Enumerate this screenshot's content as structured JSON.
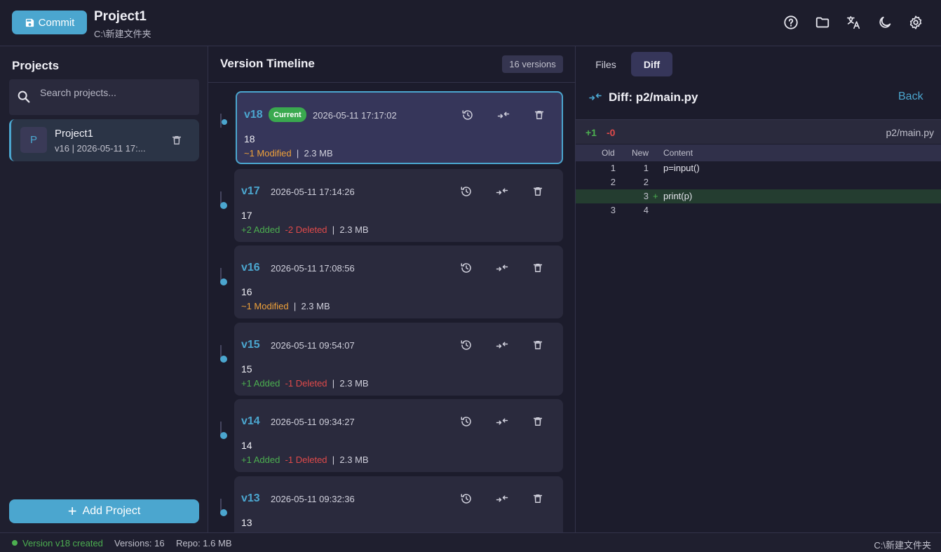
{
  "colors": {
    "accent": "#4ba6cf",
    "added": "#4caf50",
    "deleted": "#e04a4a",
    "modified": "#f0a23a",
    "current_badge": "#3aa94f"
  },
  "header": {
    "commit_label": "Commit",
    "project_title": "Project1",
    "project_path": "C:\\新建文件夹",
    "icons": [
      "help-icon",
      "folder-icon",
      "translate-icon",
      "dark-mode-icon",
      "settings-icon"
    ]
  },
  "sidebar": {
    "title": "Projects",
    "search_placeholder": "Search projects...",
    "projects": [
      {
        "avatar": "P",
        "name": "Project1",
        "meta": "v16  |  2026-05-11 17:..."
      }
    ],
    "add_label": "Add Project"
  },
  "timeline": {
    "title": "Version Timeline",
    "count": "16 versions",
    "versions": [
      {
        "label": "v18",
        "current": true,
        "badge": "Current",
        "date": "2026-05-11 17:17:02",
        "message": "18",
        "modified": "~1 Modified",
        "added": "",
        "deleted": "",
        "sep": "|",
        "size": "2.3 MB"
      },
      {
        "label": "v17",
        "current": false,
        "badge": "",
        "date": "2026-05-11 17:14:26",
        "message": "17",
        "modified": "",
        "added": "+2 Added",
        "deleted": "-2 Deleted",
        "sep": "|",
        "size": "2.3 MB"
      },
      {
        "label": "v16",
        "current": false,
        "badge": "",
        "date": "2026-05-11 17:08:56",
        "message": "16",
        "modified": "~1 Modified",
        "added": "",
        "deleted": "",
        "sep": "|",
        "size": "2.3 MB"
      },
      {
        "label": "v15",
        "current": false,
        "badge": "",
        "date": "2026-05-11 09:54:07",
        "message": "15",
        "modified": "",
        "added": "+1 Added",
        "deleted": "-1 Deleted",
        "sep": "|",
        "size": "2.3 MB"
      },
      {
        "label": "v14",
        "current": false,
        "badge": "",
        "date": "2026-05-11 09:34:27",
        "message": "14",
        "modified": "",
        "added": "+1 Added",
        "deleted": "-1 Deleted",
        "sep": "|",
        "size": "2.3 MB"
      },
      {
        "label": "v13",
        "current": false,
        "badge": "",
        "date": "2026-05-11 09:32:36",
        "message": "13",
        "modified": "",
        "added": "",
        "deleted": "",
        "sep": "",
        "size": ""
      }
    ]
  },
  "diff": {
    "tabs": [
      "Files",
      "Diff"
    ],
    "active_tab": "Diff",
    "title": "Diff: p2/main.py",
    "back_label": "Back",
    "summary_added": "+1",
    "summary_deleted": "-0",
    "file": "p2/main.py",
    "columns": [
      "Old",
      "New",
      "Content"
    ],
    "rows": [
      {
        "old": "1",
        "new": "1",
        "mark": "",
        "content": "p=input()",
        "type": "context"
      },
      {
        "old": "2",
        "new": "2",
        "mark": "",
        "content": "",
        "type": "context"
      },
      {
        "old": "",
        "new": "3",
        "mark": "+",
        "content": "print(p)",
        "type": "added"
      },
      {
        "old": "3",
        "new": "4",
        "mark": "",
        "content": "",
        "type": "context"
      }
    ]
  },
  "statusbar": {
    "message": "Version v18 created",
    "versions": "Versions: 16",
    "repo": "Repo: 1.6 MB",
    "path": "C:\\新建文件夹"
  }
}
